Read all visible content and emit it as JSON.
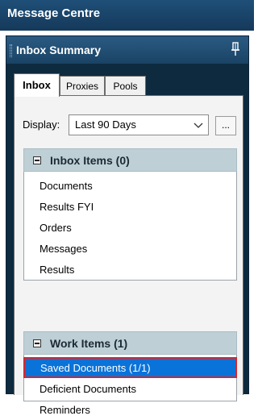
{
  "window": {
    "title": "Message Centre"
  },
  "panel": {
    "title": "Inbox Summary",
    "pin_icon": "pin-icon"
  },
  "tabs": [
    {
      "label": "Inbox",
      "active": true
    },
    {
      "label": "Proxies",
      "active": false
    },
    {
      "label": "Pools",
      "active": false
    }
  ],
  "display": {
    "label": "Display:",
    "value": "Last 90 Days",
    "more_label": "..."
  },
  "inbox_group": {
    "title": "Inbox Items (0)",
    "items": [
      "Documents",
      "Results FYI",
      "Orders",
      "Messages",
      "Results"
    ]
  },
  "work_group": {
    "title": "Work Items (1)",
    "items": [
      "Saved Documents (1/1)",
      "Deficient Documents",
      "Reminders"
    ],
    "selected_index": 0
  },
  "colors": {
    "selection": "#0a73d9",
    "highlight_border": "#d8262b",
    "group_header": "#bfcfd6"
  }
}
